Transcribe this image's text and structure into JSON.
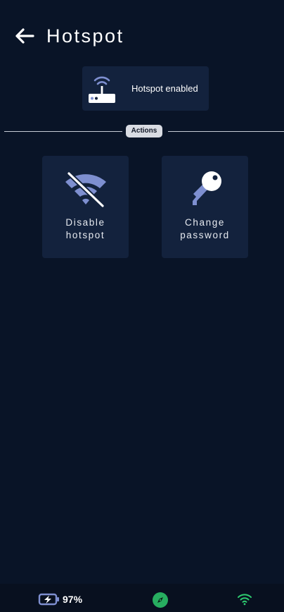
{
  "header": {
    "title": "Hotspot",
    "back_icon": "arrow-left-icon"
  },
  "status": {
    "icon": "router-icon",
    "text": "Hotspot enabled"
  },
  "section": {
    "label": "Actions"
  },
  "actions": [
    {
      "id": "disable",
      "icon": "wifi-off-icon",
      "label_line1": "Disable",
      "label_line2": "hotspot"
    },
    {
      "id": "change",
      "icon": "key-icon",
      "label_line1": "Change",
      "label_line2": "password"
    }
  ],
  "bottom_bar": {
    "battery_icon": "battery-charging-icon",
    "battery_percent": "97%",
    "compass_icon": "compass-icon",
    "wifi_icon": "wifi-icon"
  },
  "colors": {
    "background": "#091427",
    "card": "#13223d",
    "icon_accent": "#7e8fd0",
    "chip": "#d9dce3",
    "compass": "#27ae60",
    "wifi_status": "#2ecc71"
  }
}
